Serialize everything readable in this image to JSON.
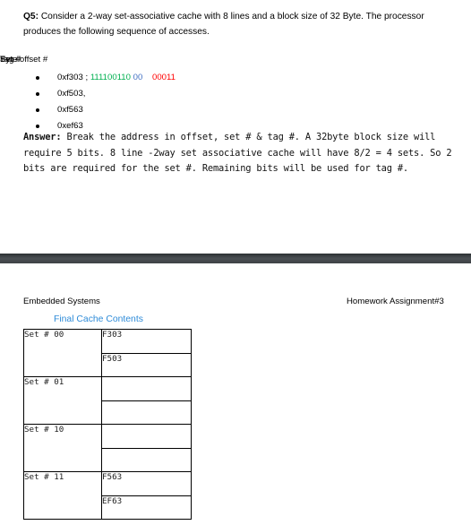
{
  "question": {
    "label": "Q5:",
    "text": " Consider a  2-way set-associative cache with 8 lines and a block size of 32 Byte. The processor produces the following sequence of accesses."
  },
  "bit_legend": {
    "tag": "Tag  #",
    "set": "Set #",
    "offset": "Byte offset #",
    "colors": {
      "tag": "#70ad47",
      "set": "#4472c4",
      "offset": "#ff0000"
    }
  },
  "accesses": [
    {
      "address": "0xf303",
      "separator": " ; ",
      "tag_bits": "111100110",
      "set_bits": " 00",
      "offset_bits": "00011"
    },
    {
      "address": "0xf503,"
    },
    {
      "address": "0xf563"
    },
    {
      "address": "0xef63"
    }
  ],
  "answer": {
    "label": "Answer:",
    "text": " Break the address in offset, set # & tag #. A 32byte block size will require 5 bits. 8 line -2way set associative cache will have 8/2 = 4 sets. So 2 bits are required for the set #. Remaining bits will be used for tag #."
  },
  "page_header": {
    "left": "Embedded Systems",
    "right": "Homework Assignment#3"
  },
  "cache_table": {
    "caption": "Final Cache Contents",
    "sets": [
      {
        "label": "Set # 00",
        "ways": [
          "F303",
          "F503"
        ]
      },
      {
        "label": "Set # 01",
        "ways": [
          "",
          ""
        ]
      },
      {
        "label": "Set # 10",
        "ways": [
          "",
          ""
        ]
      },
      {
        "label": "Set # 11",
        "ways": [
          "F563",
          "EF63"
        ]
      }
    ]
  }
}
